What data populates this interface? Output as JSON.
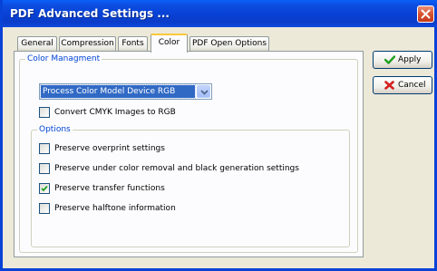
{
  "window": {
    "title": "PDF Advanced Settings ..."
  },
  "tabs": [
    {
      "label": "General",
      "active": false
    },
    {
      "label": "Compression",
      "active": false
    },
    {
      "label": "Fonts",
      "active": false
    },
    {
      "label": "Color",
      "active": true
    },
    {
      "label": "PDF Open Options",
      "active": false
    }
  ],
  "color_management": {
    "title": "Color Managment",
    "color_model": {
      "selected": "Process Color Model Device RGB"
    },
    "convert_cmyk": {
      "label": "Convert CMYK Images to RGB",
      "checked": false
    }
  },
  "options": {
    "title": "Options",
    "items": [
      {
        "label": "Preserve overprint settings",
        "checked": false
      },
      {
        "label": "Preserve under color removal and black generation settings",
        "checked": false
      },
      {
        "label": "Preserve transfer functions",
        "checked": true
      },
      {
        "label": "Preserve halftone information",
        "checked": false
      }
    ]
  },
  "buttons": {
    "apply": "Apply",
    "cancel": "Cancel"
  },
  "colors": {
    "titlebar": "#0842d6",
    "group_title": "#0046d5",
    "check_mark": "#21a121",
    "apply_icon": "#21a121",
    "cancel_icon": "#d42020"
  },
  "icons": {
    "close": "close-icon",
    "apply": "checkmark-icon",
    "cancel": "x-mark-icon",
    "dropdown": "chevron-down-icon"
  }
}
